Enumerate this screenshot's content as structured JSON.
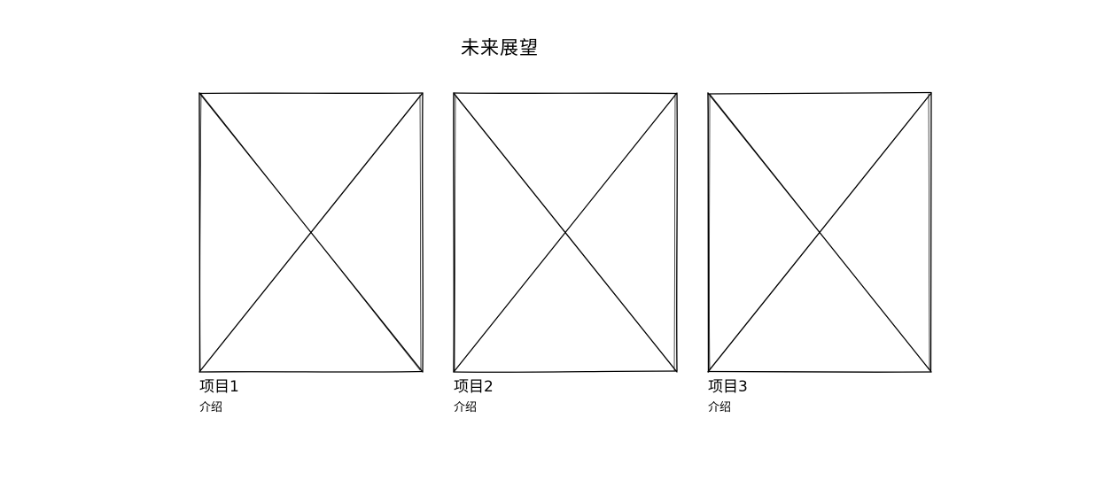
{
  "header": {
    "title": "未来展望"
  },
  "projects": [
    {
      "title": "项目1",
      "description": "介绍"
    },
    {
      "title": "项目2",
      "description": "介绍"
    },
    {
      "title": "项目3",
      "description": "介绍"
    }
  ],
  "colors": {
    "background": "#ffffff",
    "stroke": "#000000"
  }
}
